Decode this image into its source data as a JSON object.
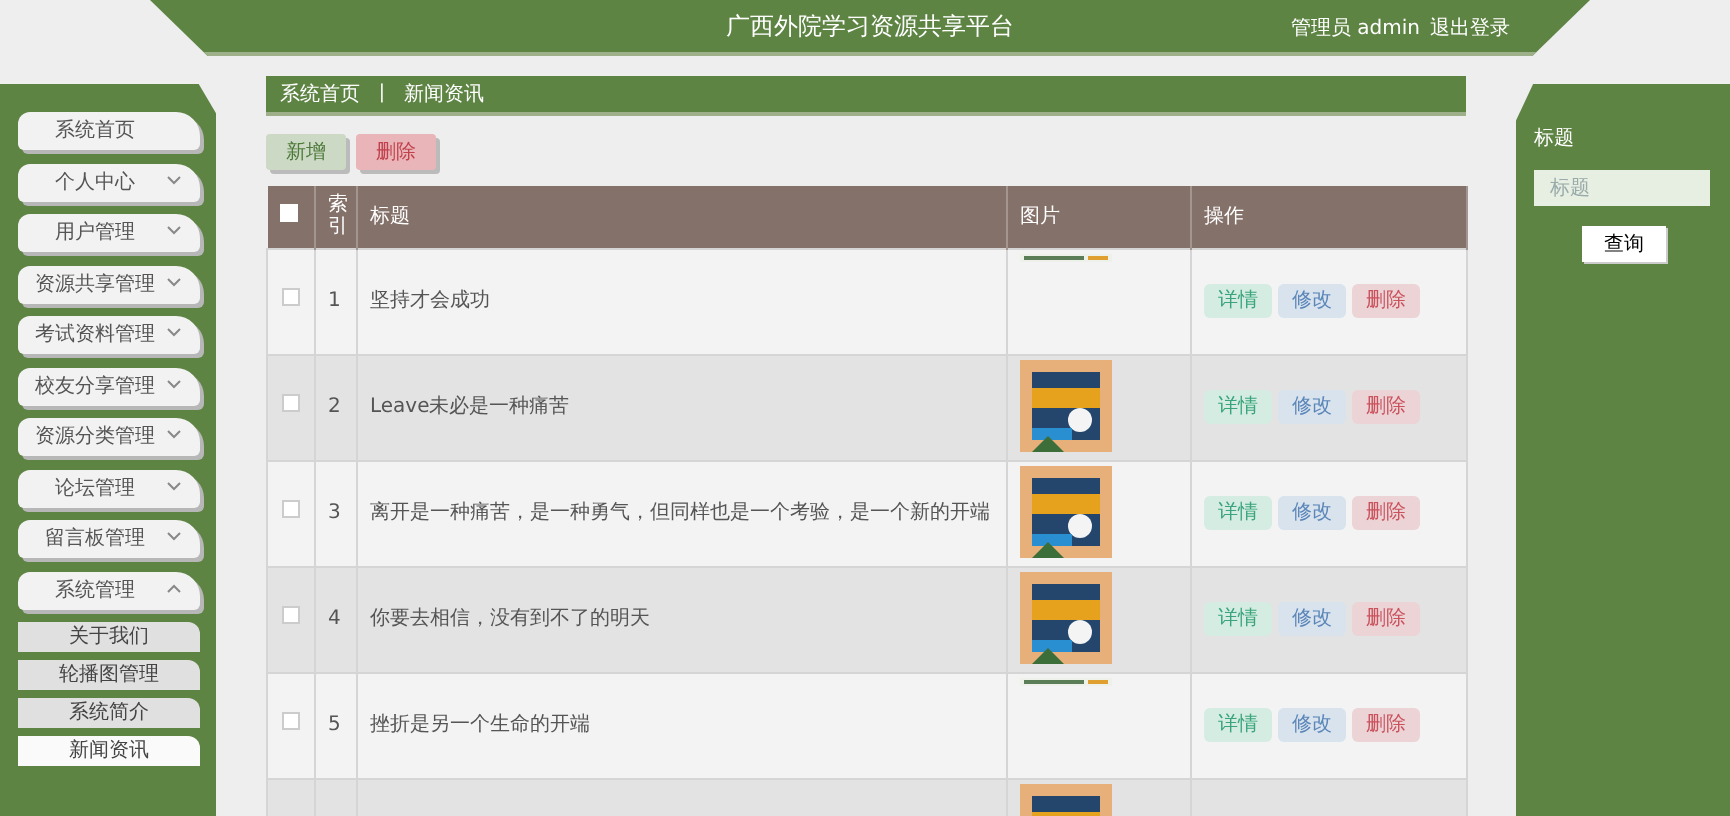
{
  "header": {
    "title": "广西外院学习资源共享平台",
    "user": "管理员 admin",
    "logout": "退出登录"
  },
  "sidebar": {
    "items": [
      {
        "label": "系统首页",
        "kind": "link"
      },
      {
        "label": "个人中心",
        "kind": "group",
        "expanded": false
      },
      {
        "label": "用户管理",
        "kind": "group",
        "expanded": false
      },
      {
        "label": "资源共享管理",
        "kind": "group",
        "expanded": false
      },
      {
        "label": "考试资料管理",
        "kind": "group",
        "expanded": false
      },
      {
        "label": "校友分享管理",
        "kind": "group",
        "expanded": false
      },
      {
        "label": "资源分类管理",
        "kind": "group",
        "expanded": false
      },
      {
        "label": "论坛管理",
        "kind": "group",
        "expanded": false
      },
      {
        "label": "留言板管理",
        "kind": "group",
        "expanded": false
      },
      {
        "label": "系统管理",
        "kind": "group",
        "expanded": true,
        "children": [
          {
            "label": "关于我们",
            "selected": false
          },
          {
            "label": "轮播图管理",
            "selected": false
          },
          {
            "label": "系统简介",
            "selected": false
          },
          {
            "label": "新闻资讯",
            "selected": true
          }
        ]
      }
    ]
  },
  "breadcrumb": [
    "系统首页",
    "新闻资讯"
  ],
  "breadcrumb_separator": "〡",
  "toolbar": [
    {
      "label": "新增",
      "kind": "add"
    },
    {
      "label": "删除",
      "kind": "delete"
    }
  ],
  "table": {
    "select_all_checked": false,
    "columns": [
      "索引",
      "标题",
      "图片",
      "操作"
    ],
    "rows": [
      {
        "checked": false,
        "index": "1",
        "title": "坚持才会成功",
        "image": {
          "kind": "picture",
          "loaded": false
        },
        "actions": [
          {
            "label": "详情",
            "kind": "view"
          },
          {
            "label": "修改",
            "kind": "edit"
          },
          {
            "label": "删除",
            "kind": "delete"
          }
        ]
      },
      {
        "checked": false,
        "index": "2",
        "title": "Leave未必是一种痛苦",
        "image": {
          "kind": "picture",
          "loaded": true
        },
        "actions": [
          {
            "label": "详情",
            "kind": "view"
          },
          {
            "label": "修改",
            "kind": "edit"
          },
          {
            "label": "删除",
            "kind": "delete"
          }
        ]
      },
      {
        "checked": false,
        "index": "3",
        "title": "离开是一种痛苦，是一种勇气，但同样也是一个考验，是一个新的开端",
        "image": {
          "kind": "picture",
          "loaded": true
        },
        "actions": [
          {
            "label": "详情",
            "kind": "view"
          },
          {
            "label": "修改",
            "kind": "edit"
          },
          {
            "label": "删除",
            "kind": "delete"
          }
        ]
      },
      {
        "checked": false,
        "index": "4",
        "title": "你要去相信，没有到不了的明天",
        "image": {
          "kind": "picture",
          "loaded": true
        },
        "actions": [
          {
            "label": "详情",
            "kind": "view"
          },
          {
            "label": "修改",
            "kind": "edit"
          },
          {
            "label": "删除",
            "kind": "delete"
          }
        ]
      },
      {
        "checked": false,
        "index": "5",
        "title": "挫折是另一个生命的开端",
        "image": {
          "kind": "picture",
          "loaded": false
        },
        "actions": [
          {
            "label": "详情",
            "kind": "view"
          },
          {
            "label": "修改",
            "kind": "edit"
          },
          {
            "label": "删除",
            "kind": "delete"
          }
        ]
      },
      {
        "image": {
          "kind": "picture",
          "loaded": true
        }
      }
    ]
  },
  "search": {
    "label": "标题",
    "placeholder": "标题",
    "button": "查询"
  }
}
